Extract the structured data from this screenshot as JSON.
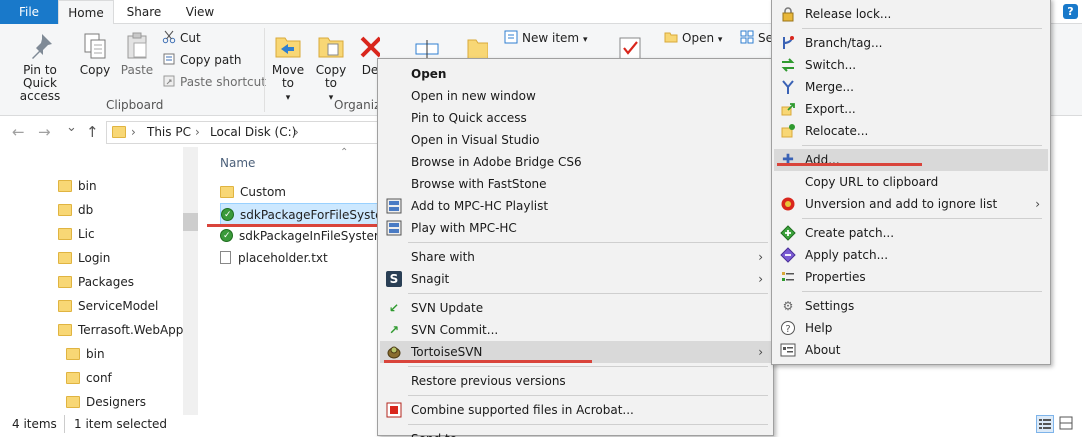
{
  "ribbon": {
    "tabs": [
      "File",
      "Home",
      "Share",
      "View"
    ],
    "help_label": "?",
    "clipboard": {
      "pin": "Pin to Quick access",
      "copy": "Copy",
      "paste": "Paste",
      "cut": "Cut",
      "copy_path": "Copy path",
      "paste_shortcut": "Paste shortcut",
      "group_label": "Clipboard"
    },
    "organize": {
      "move_to": "Move to",
      "copy_to": "Copy to",
      "delete_partial": "De",
      "group_label_partial": "Organiz"
    },
    "new": {
      "new_item": "New item"
    },
    "open": {
      "open": "Open",
      "select_partial": "Se"
    }
  },
  "address": {
    "back": "←",
    "forward": "→",
    "recent": "⌄",
    "up": "↑",
    "crumbs": [
      "This PC",
      "Local Disk (C:)"
    ],
    "sep": "›"
  },
  "nav_items": [
    {
      "label": "bin"
    },
    {
      "label": "db"
    },
    {
      "label": "Lic"
    },
    {
      "label": "Login"
    },
    {
      "label": "Packages"
    },
    {
      "label": "ServiceModel"
    },
    {
      "label": "Terrasoft.WebApp"
    },
    {
      "label": "bin"
    },
    {
      "label": "conf"
    },
    {
      "label": "Designers"
    }
  ],
  "filelist": {
    "column_header": "Name",
    "items": [
      {
        "label": "Custom",
        "type": "folder"
      },
      {
        "label": "sdkPackageForFileSystem",
        "type": "svn",
        "selected": true
      },
      {
        "label": "sdkPackageInFileSystem",
        "type": "svn"
      },
      {
        "label": "placeholder.txt",
        "type": "file"
      }
    ]
  },
  "status": {
    "items_count": "4 items",
    "selected_count": "1 item selected"
  },
  "context_menu": {
    "items": [
      {
        "label": "Open",
        "bold": true
      },
      {
        "label": "Open in new window"
      },
      {
        "label": "Pin to Quick access"
      },
      {
        "label": "Open in Visual Studio"
      },
      {
        "label": "Browse in Adobe Bridge CS6"
      },
      {
        "label": "Browse with FastStone"
      },
      {
        "label": "Add to MPC-HC Playlist"
      },
      {
        "label": "Play with MPC-HC"
      },
      {
        "label": "Share with"
      },
      {
        "label": "Snagit"
      },
      {
        "label": "SVN Update"
      },
      {
        "label": "SVN Commit..."
      },
      {
        "label": "TortoiseSVN"
      },
      {
        "label": "Restore previous versions"
      },
      {
        "label": "Combine supported files in Acrobat..."
      },
      {
        "label": "Send to"
      }
    ],
    "submenu_arrow": "›"
  },
  "tortoise_menu": {
    "items": [
      {
        "label": "Release lock..."
      },
      {
        "label": "Branch/tag..."
      },
      {
        "label": "Switch..."
      },
      {
        "label": "Merge..."
      },
      {
        "label": "Export..."
      },
      {
        "label": "Relocate..."
      },
      {
        "label": "Add..."
      },
      {
        "label": "Copy URL to clipboard"
      },
      {
        "label": "Unversion and add to ignore list"
      },
      {
        "label": "Create patch..."
      },
      {
        "label": "Apply patch..."
      },
      {
        "label": "Properties"
      },
      {
        "label": "Settings"
      },
      {
        "label": "Help"
      },
      {
        "label": "About"
      }
    ]
  },
  "colors": {
    "file_tab": "#1979ca",
    "selection": "#cce8ff",
    "highlight_underline": "#d9443b",
    "menu_bg": "#f2f2f2"
  }
}
